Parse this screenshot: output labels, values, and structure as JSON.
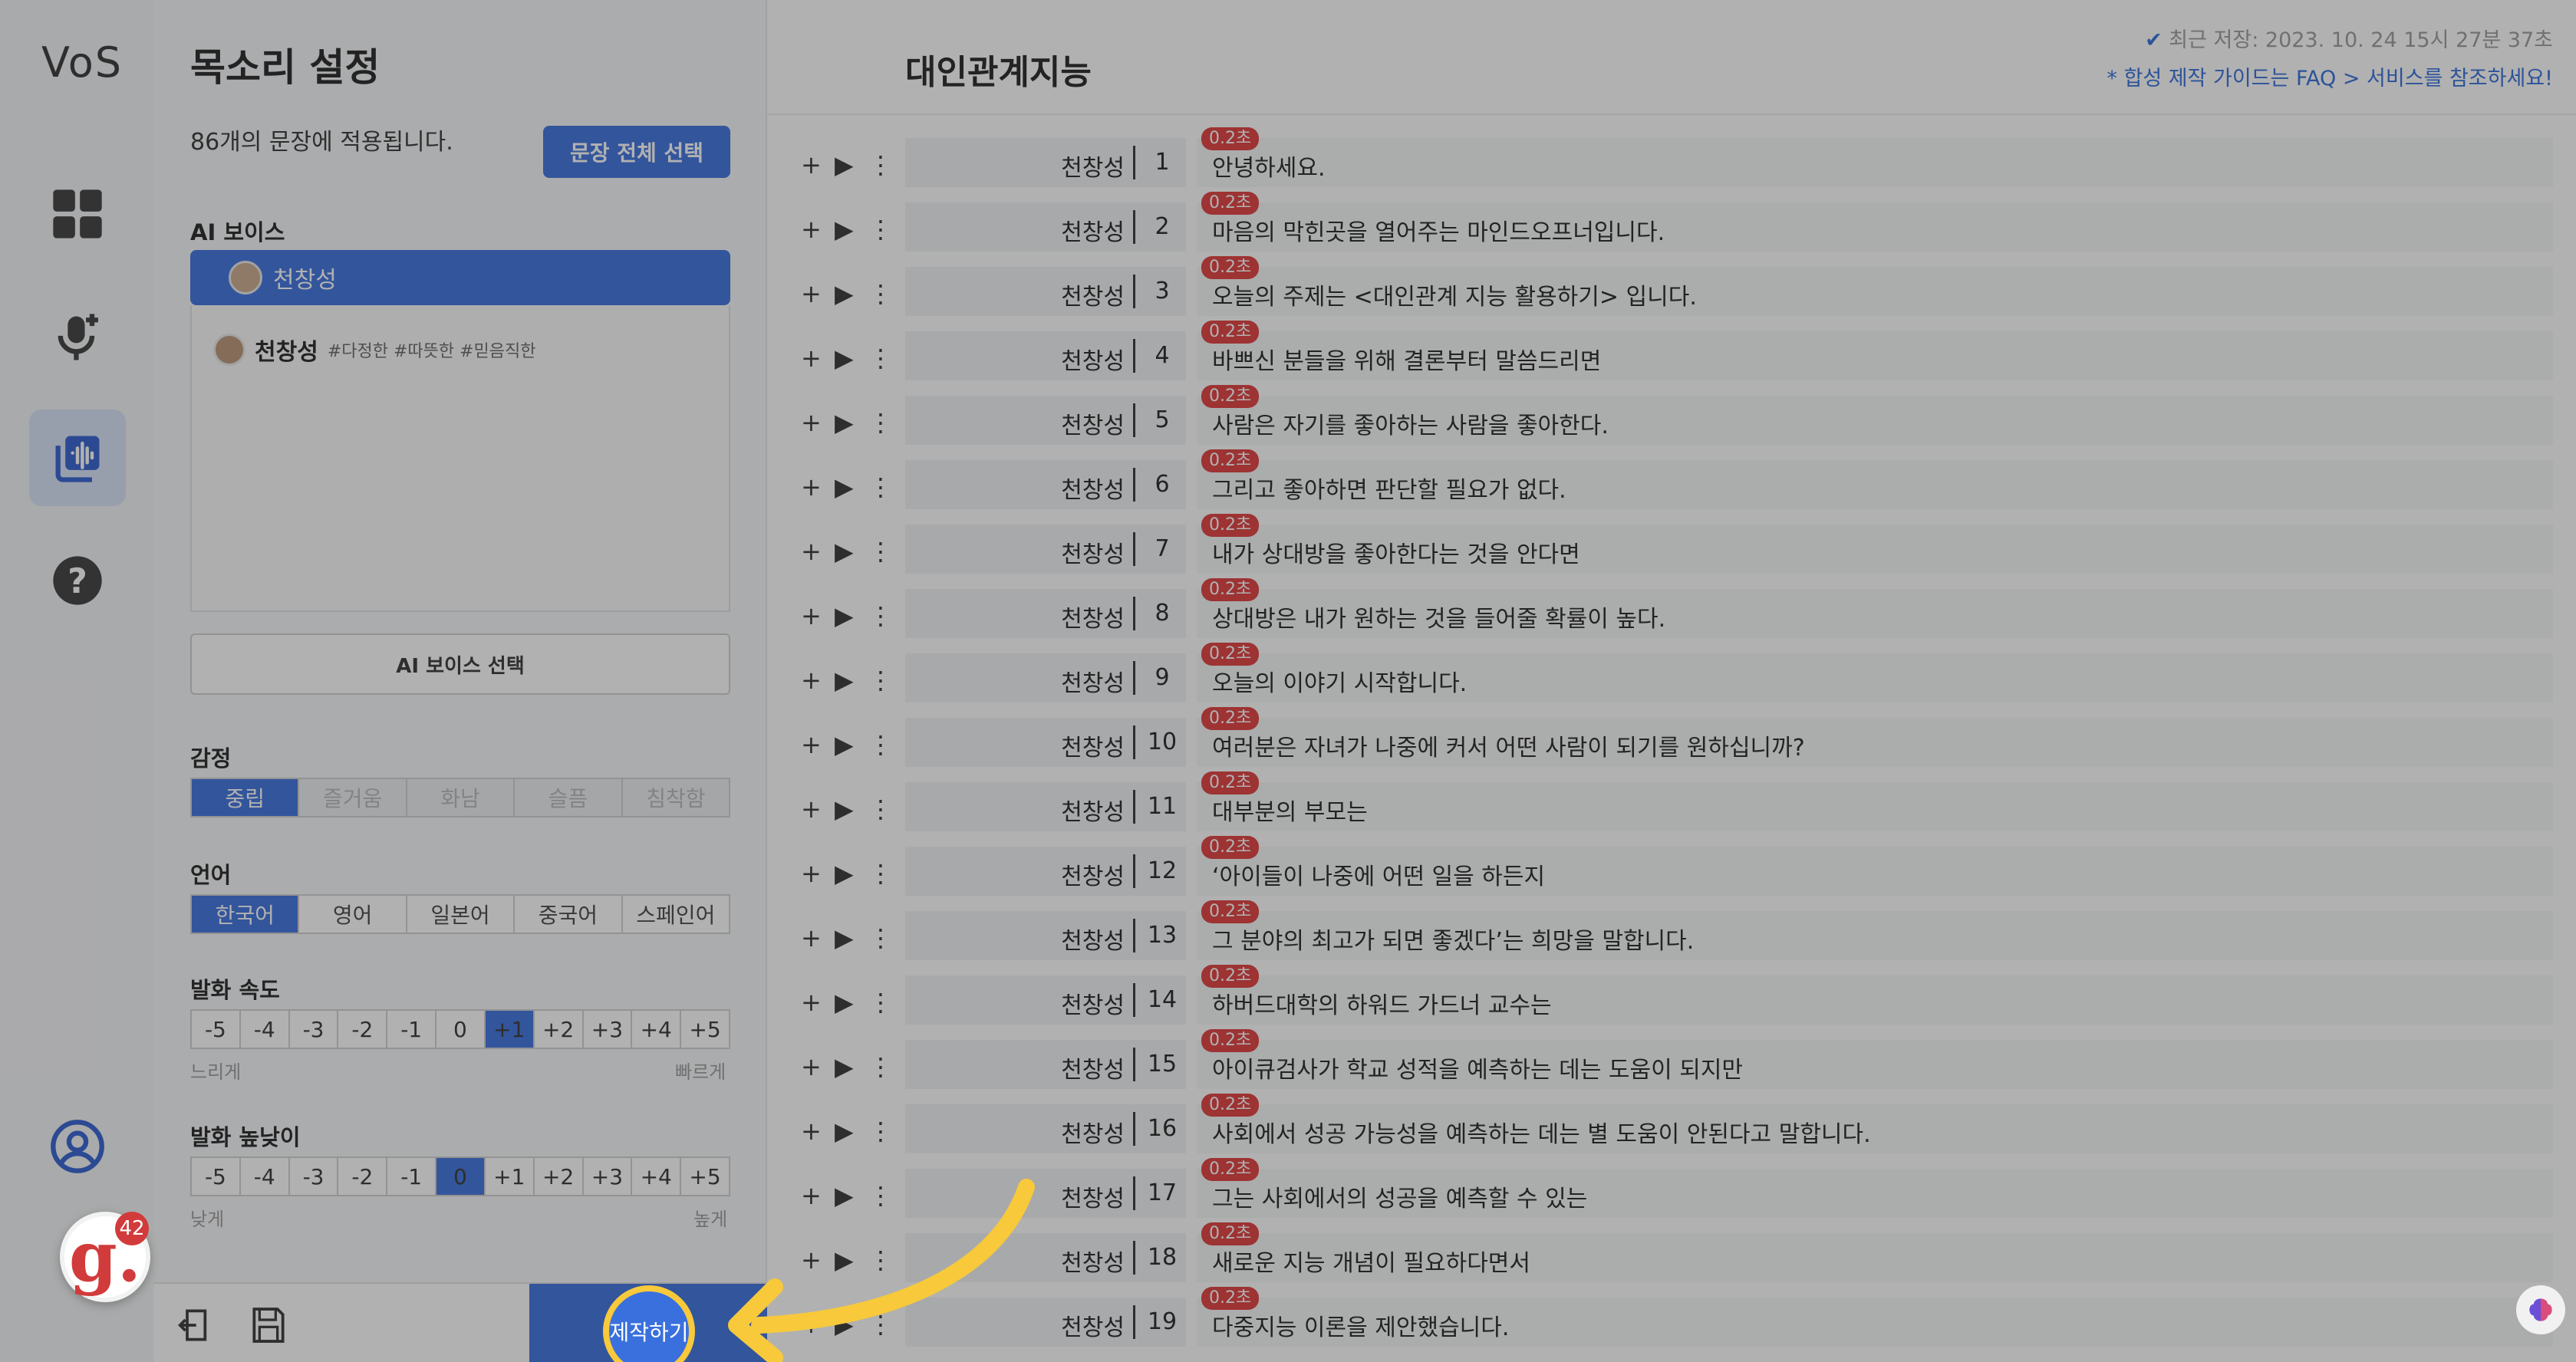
{
  "app": {
    "logo": "VoS"
  },
  "nav": {
    "items": [
      "dashboard-icon",
      "mic-add-icon",
      "voice-library-icon",
      "help-icon"
    ],
    "profile": "user-icon"
  },
  "panel": {
    "title": "목소리 설정",
    "applied_text": "86개의 문장에 적용됩니다.",
    "select_all_label": "문장 전체 선택",
    "ai_voice_label": "AI 보이스",
    "selected_voice": "천창성",
    "voice_list": [
      {
        "name": "천창성",
        "tags": "#다정한 #따뜻한 #믿음직한"
      }
    ],
    "ai_voice_button": "AI 보이스 선택",
    "emotion": {
      "label": "감정",
      "options": [
        "중립",
        "즐거움",
        "화남",
        "슬픔",
        "침착함"
      ],
      "selected": "중립"
    },
    "language": {
      "label": "언어",
      "options": [
        "한국어",
        "영어",
        "일본어",
        "중국어",
        "스페인어"
      ],
      "selected": "한국어"
    },
    "speed": {
      "label": "발화 속도",
      "options": [
        "-5",
        "-4",
        "-3",
        "-2",
        "-1",
        "0",
        "+1",
        "+2",
        "+3",
        "+4",
        "+5"
      ],
      "selected": "+1",
      "min_hint": "느리게",
      "max_hint": "빠르게"
    },
    "pitch": {
      "label": "발화 높낮이",
      "options": [
        "-5",
        "-4",
        "-3",
        "-2",
        "-1",
        "0",
        "+1",
        "+2",
        "+3",
        "+4",
        "+5"
      ],
      "selected": "0",
      "min_hint": "낮게",
      "max_hint": "높게"
    },
    "produce_button": "제작하기"
  },
  "main": {
    "title": "대인관계지능",
    "last_saved": "최근 저장: 2023. 10. 24 15시 27분 37초",
    "guide_note": "* 합성 제작 가이드는 FAQ > 서비스를 참조하세요!",
    "badge": "0.2초",
    "rows": [
      {
        "speaker": "천창성",
        "index": "1",
        "text": "안녕하세요."
      },
      {
        "speaker": "천창성",
        "index": "2",
        "text": "마음의 막힌곳을 열어주는 마인드오프너입니다."
      },
      {
        "speaker": "천창성",
        "index": "3",
        "text": "오늘의 주제는 <대인관계 지능 활용하기> 입니다."
      },
      {
        "speaker": "천창성",
        "index": "4",
        "text": "바쁘신 분들을 위해 결론부터 말씀드리면"
      },
      {
        "speaker": "천창성",
        "index": "5",
        "text": "사람은 자기를 좋아하는 사람을 좋아한다."
      },
      {
        "speaker": "천창성",
        "index": "6",
        "text": "그리고 좋아하면 판단할 필요가 없다."
      },
      {
        "speaker": "천창성",
        "index": "7",
        "text": "내가 상대방을 좋아한다는 것을 안다면"
      },
      {
        "speaker": "천창성",
        "index": "8",
        "text": "상대방은 내가 원하는 것을 들어줄 확률이 높다."
      },
      {
        "speaker": "천창성",
        "index": "9",
        "text": "오늘의 이야기 시작합니다."
      },
      {
        "speaker": "천창성",
        "index": "10",
        "text": "여러분은 자녀가 나중에 커서 어떤 사람이 되기를 원하십니까?"
      },
      {
        "speaker": "천창성",
        "index": "11",
        "text": "대부분의 부모는"
      },
      {
        "speaker": "천창성",
        "index": "12",
        "text": "‘아이들이 나중에 어떤 일을 하든지"
      },
      {
        "speaker": "천창성",
        "index": "13",
        "text": "그 분야의 최고가 되면 좋겠다’는 희망을 말합니다."
      },
      {
        "speaker": "천창성",
        "index": "14",
        "text": "하버드대학의 하워드 가드너 교수는"
      },
      {
        "speaker": "천창성",
        "index": "15",
        "text": "아이큐검사가 학교 성적을 예측하는 데는 도움이 되지만"
      },
      {
        "speaker": "천창성",
        "index": "16",
        "text": "사회에서 성공 가능성을 예측하는 데는 별 도움이 안된다고 말합니다."
      },
      {
        "speaker": "천창성",
        "index": "17",
        "text": "그는 사회에서의 성공을 예측할 수 있는"
      },
      {
        "speaker": "천창성",
        "index": "18",
        "text": "새로운 지능 개념이 필요하다면서"
      },
      {
        "speaker": "천창성",
        "index": "19",
        "text": "다중지능 이론을 제안했습니다."
      }
    ]
  },
  "overlay": {
    "g_count": "42",
    "g_letter": "g."
  },
  "colors": {
    "accent": "#3a70de",
    "badge": "#e03b3b",
    "arrow": "#f7c93b"
  }
}
